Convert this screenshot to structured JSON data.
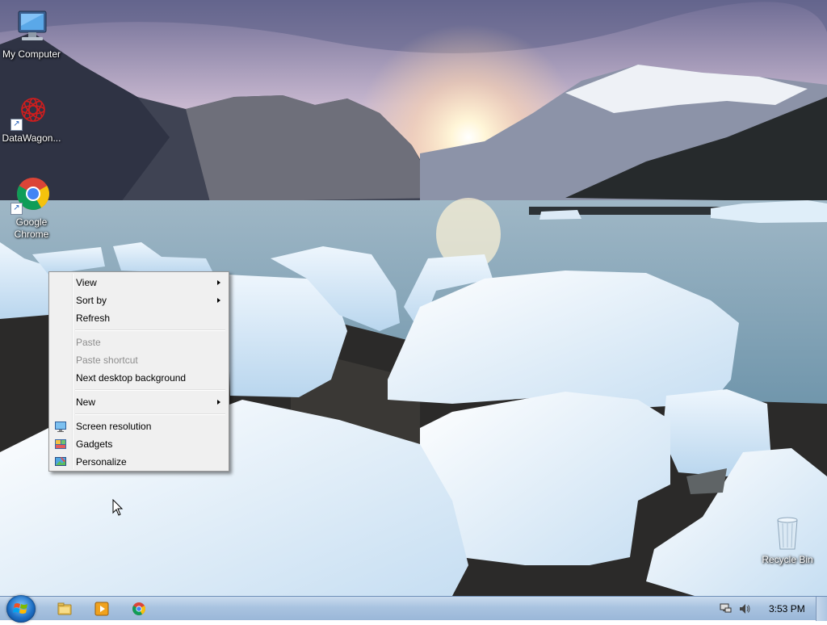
{
  "desktop": {
    "icons": [
      {
        "label": "My Computer",
        "icon": "computer-icon"
      },
      {
        "label": "DataWagon...",
        "icon": "datawagon-icon"
      },
      {
        "label_line1": "Google",
        "label_line2": "Chrome",
        "icon": "chrome-icon"
      },
      {
        "label": "Recycle Bin",
        "icon": "recycle-bin-icon"
      }
    ]
  },
  "context_menu": {
    "items": [
      {
        "label": "View",
        "submenu": true,
        "enabled": true
      },
      {
        "label": "Sort by",
        "submenu": true,
        "enabled": true
      },
      {
        "label": "Refresh",
        "submenu": false,
        "enabled": true
      },
      {
        "label": "Paste",
        "submenu": false,
        "enabled": false
      },
      {
        "label": "Paste shortcut",
        "submenu": false,
        "enabled": false
      },
      {
        "label": "Next desktop background",
        "submenu": false,
        "enabled": true
      },
      {
        "label": "New",
        "submenu": true,
        "enabled": true
      },
      {
        "label": "Screen resolution",
        "icon": "screen-resolution-icon",
        "enabled": true
      },
      {
        "label": "Gadgets",
        "icon": "gadgets-icon",
        "enabled": true
      },
      {
        "label": "Personalize",
        "icon": "personalize-icon",
        "enabled": true
      }
    ]
  },
  "taskbar": {
    "pinned": [
      "windows-explorer-icon",
      "media-player-icon",
      "chrome-icon"
    ],
    "tray": [
      "network-icon",
      "volume-icon"
    ],
    "clock": "3:53 PM"
  },
  "colors": {
    "menu_bg": "#f0f0f0",
    "disabled_text": "#8d8d8d",
    "taskbar_top": "#c9dbee"
  }
}
